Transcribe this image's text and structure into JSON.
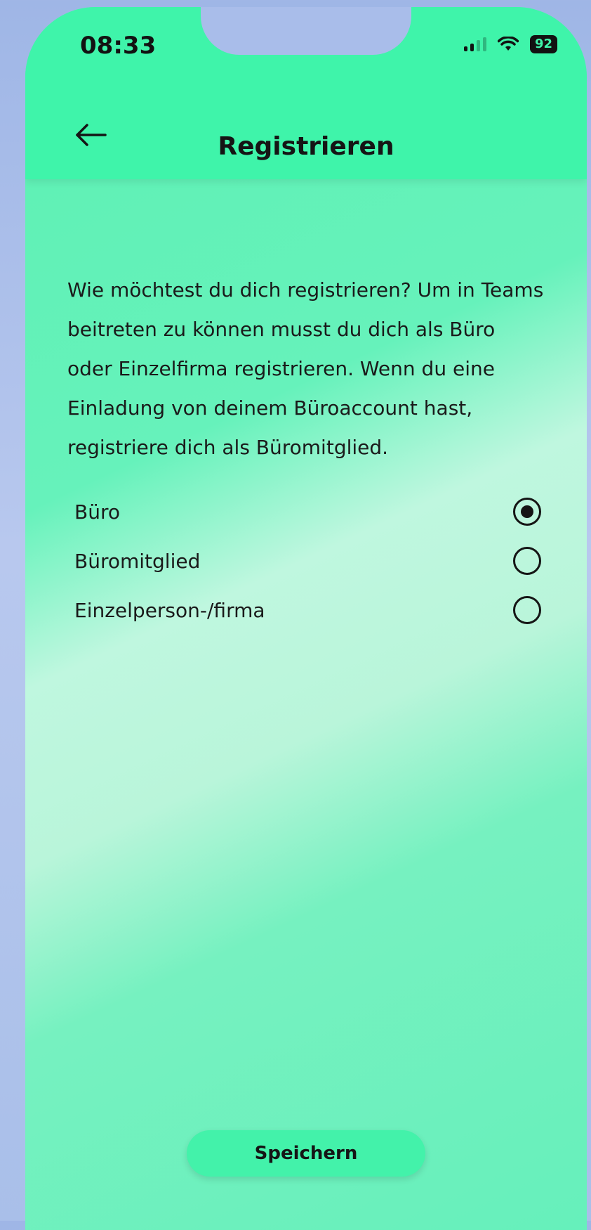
{
  "status_bar": {
    "time": "08:33",
    "battery": "92",
    "signal_icon": "cellular-signal-icon",
    "wifi_icon": "wifi-icon"
  },
  "header": {
    "title": "Registrieren",
    "back_icon": "arrow-left-icon"
  },
  "main": {
    "intro_text": "Wie möchtest du dich registrieren? Um in Teams beitreten zu können musst du dich als Büro oder Einzelfirma registrieren. Wenn du eine Einladung von deinem Büroaccount hast, registriere dich als Büromitglied.",
    "options": [
      {
        "label": "Büro",
        "selected": true
      },
      {
        "label": "Büromitglied",
        "selected": false
      },
      {
        "label": "Einzelperson-/firma",
        "selected": false
      }
    ]
  },
  "footer": {
    "save_label": "Speichern"
  },
  "colors": {
    "accent": "#3ff4aa",
    "text": "#151515",
    "background_page": "#a9bfe9"
  }
}
